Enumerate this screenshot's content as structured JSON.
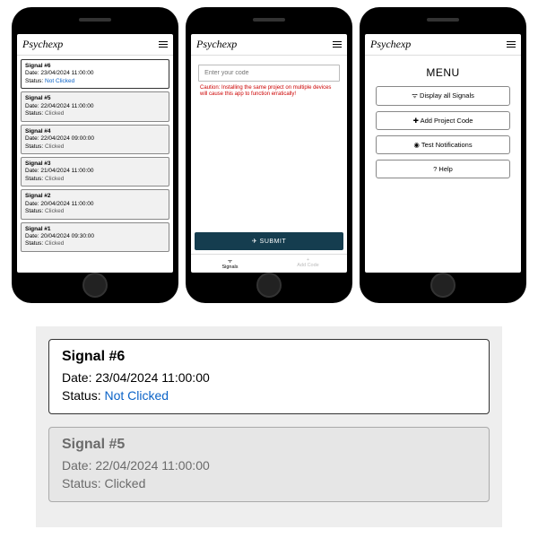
{
  "app_title": "Psychexp",
  "phone1": {
    "signals": [
      {
        "title": "Signal #6",
        "date": "Date: 23/04/2024 11:00:00",
        "status_label": "Status: ",
        "status": "Not Clicked",
        "clicked": false
      },
      {
        "title": "Signal #5",
        "date": "Date: 22/04/2024 11:00:00",
        "status_label": "Status: ",
        "status": "Clicked",
        "clicked": true
      },
      {
        "title": "Signal #4",
        "date": "Date: 22/04/2024 09:00:00",
        "status_label": "Status: ",
        "status": "Clicked",
        "clicked": true
      },
      {
        "title": "Signal #3",
        "date": "Date: 21/04/2024 11:00:00",
        "status_label": "Status: ",
        "status": "Clicked",
        "clicked": true
      },
      {
        "title": "Signal #2",
        "date": "Date: 20/04/2024 11:00:00",
        "status_label": "Status: ",
        "status": "Clicked",
        "clicked": true
      },
      {
        "title": "Signal #1",
        "date": "Date: 20/04/2024 09:30:00",
        "status_label": "Status: ",
        "status": "Clicked",
        "clicked": true
      }
    ]
  },
  "phone2": {
    "placeholder": "Enter your code",
    "caution": "Caution: Installing the same project on multiple devices will cause this app to function erratically!",
    "submit": "SUBMIT",
    "tabs": {
      "signals": "Signals",
      "add": "Add Code"
    }
  },
  "phone3": {
    "menu_title": "MENU",
    "items": {
      "display": "Display all Signals",
      "add": "Add Project Code",
      "test": "Test Notifications",
      "help": "Help"
    },
    "icons": {
      "wifi": "ᯤ",
      "plus": "✚",
      "bell": "◉",
      "question": "?"
    }
  },
  "detail": {
    "card1": {
      "title": "Signal #6",
      "date": "Date: 23/04/2024 11:00:00",
      "status_prefix": "Status: ",
      "status": "Not Clicked"
    },
    "card2": {
      "title": "Signal #5",
      "date": "Date: 22/04/2024 11:00:00",
      "status_full": "Status: Clicked"
    }
  }
}
